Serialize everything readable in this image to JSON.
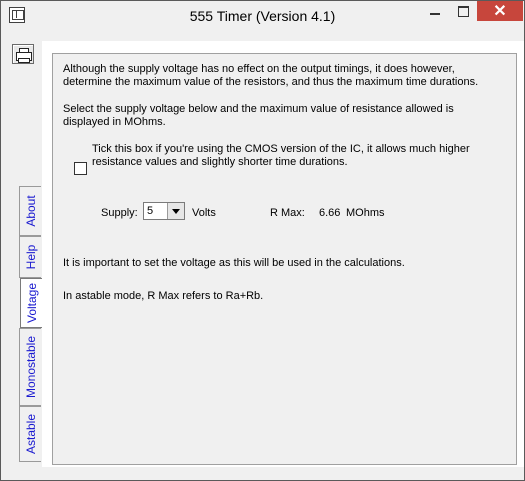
{
  "window": {
    "title": "555 Timer  (Version 4.1)",
    "close_symbol": "✕"
  },
  "toolbar": {
    "print_icon": "printer-icon"
  },
  "tabs": [
    {
      "label": "About"
    },
    {
      "label": "Help"
    },
    {
      "label": "Voltage",
      "active": true
    },
    {
      "label": "Monostable"
    },
    {
      "label": "Astable"
    }
  ],
  "content": {
    "intro_line1": "Although the supply voltage has no effect on the output timings, it does however,",
    "intro_line2": "determine the maximum value of the resistors, and thus the maximum time durations.",
    "select_line1": "Select the supply voltage below and the maximum value of resistance allowed is",
    "select_line2": "displayed in MOhms.",
    "cmos_line1": "Tick this box if you're using the CMOS version of the IC, it allows much higher",
    "cmos_line2": "resistance values and slightly shorter time durations.",
    "cmos_checked": false,
    "supply_label": "Supply:",
    "supply_value": "5",
    "volts_label": "Volts",
    "rmax_label": "R Max:",
    "rmax_value": "6.66",
    "rmax_unit": "MOhms",
    "note_voltage": "It is important to set the voltage as this will be used in the calculations.",
    "note_astable": "In astable mode, R Max refers to Ra+Rb."
  },
  "colors": {
    "tab_text": "#1a1ad0",
    "close_button": "#c7463c"
  }
}
